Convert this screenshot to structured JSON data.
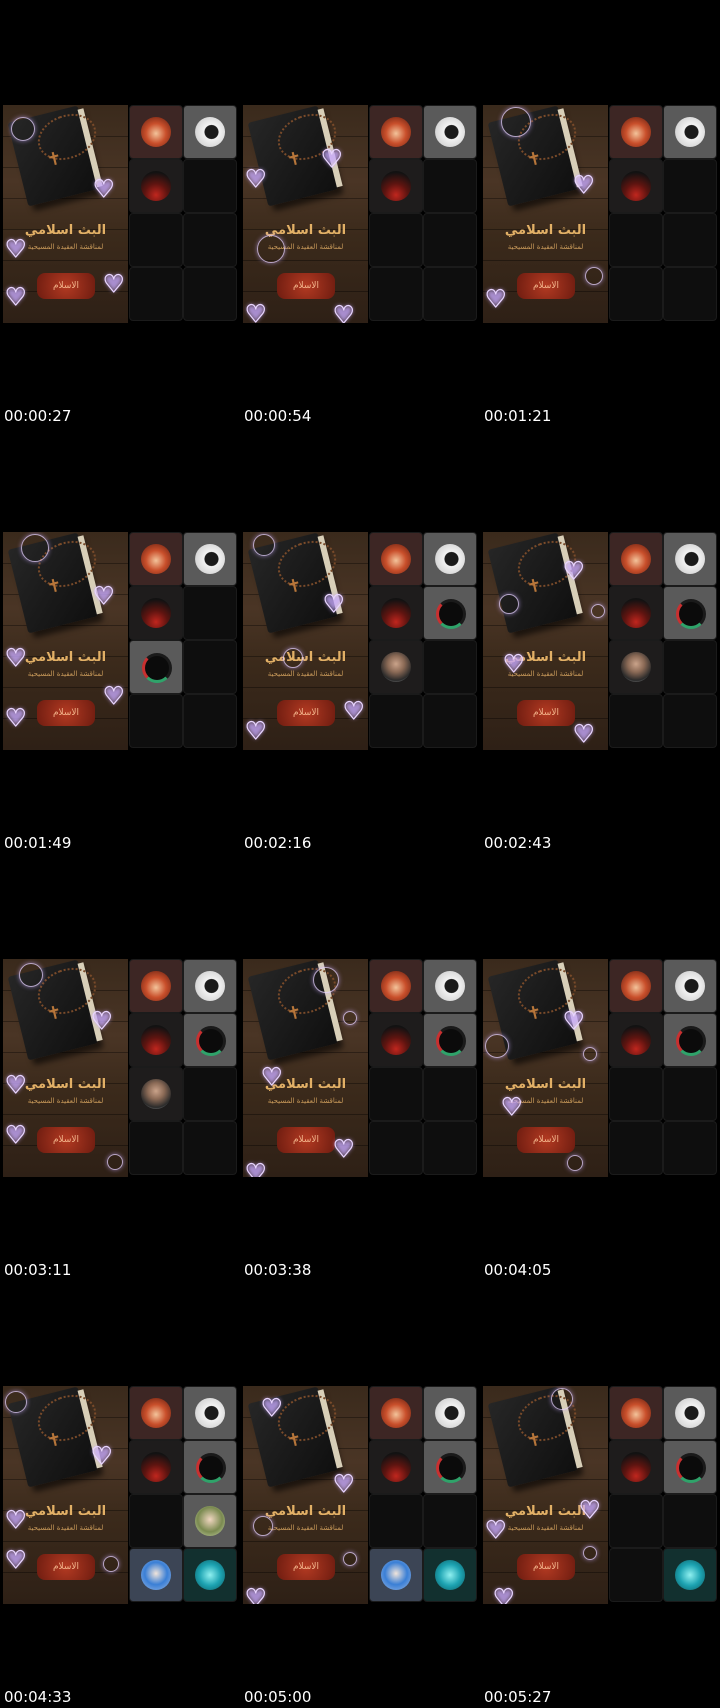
{
  "frames": [
    {
      "timestamp": "00:00:27",
      "tiles": [
        "fire",
        "wolf",
        "red",
        "",
        "",
        "",
        "",
        ""
      ]
    },
    {
      "timestamp": "00:00:54",
      "tiles": [
        "fire",
        "wolf",
        "red",
        "",
        "",
        "",
        "",
        ""
      ]
    },
    {
      "timestamp": "00:01:21",
      "tiles": [
        "fire",
        "wolf",
        "red",
        "",
        "",
        "",
        "",
        ""
      ]
    },
    {
      "timestamp": "00:01:49",
      "tiles": [
        "fire",
        "wolf",
        "red",
        "",
        "ring",
        "",
        "",
        ""
      ]
    },
    {
      "timestamp": "00:02:16",
      "tiles": [
        "fire",
        "wolf",
        "red",
        "ring",
        "man",
        "",
        "",
        ""
      ]
    },
    {
      "timestamp": "00:02:43",
      "tiles": [
        "fire",
        "wolf",
        "red",
        "ring",
        "man",
        "",
        "",
        ""
      ]
    },
    {
      "timestamp": "00:03:11",
      "tiles": [
        "fire",
        "wolf",
        "red",
        "ring",
        "man",
        "",
        "",
        ""
      ]
    },
    {
      "timestamp": "00:03:38",
      "tiles": [
        "fire",
        "wolf",
        "red",
        "ring",
        "",
        "",
        "",
        ""
      ]
    },
    {
      "timestamp": "00:04:05",
      "tiles": [
        "fire",
        "wolf",
        "red",
        "ring",
        "",
        "",
        "",
        ""
      ]
    },
    {
      "timestamp": "00:04:33",
      "tiles": [
        "fire",
        "wolf",
        "red",
        "ring",
        "",
        "boy",
        "bluep",
        "cyan"
      ]
    },
    {
      "timestamp": "00:05:00",
      "tiles": [
        "fire",
        "wolf",
        "red",
        "ring",
        "",
        "",
        "bluep",
        "cyan"
      ]
    },
    {
      "timestamp": "00:05:27",
      "tiles": [
        "fire",
        "wolf",
        "red",
        "ring",
        "",
        "",
        "",
        "cyan"
      ]
    }
  ],
  "poster": {
    "title": "البث اسلامي",
    "subtitle": "لمناقشة العقيدة المسيحية",
    "badge": "الاسلام"
  }
}
